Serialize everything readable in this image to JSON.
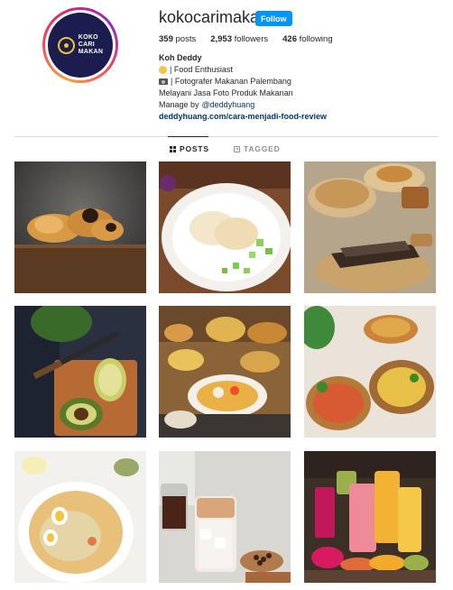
{
  "profile": {
    "username": "kokocarimakan",
    "follow_label": "Follow",
    "avatar_text": [
      "KOKO",
      "CARI",
      "MAKAN"
    ],
    "stats": {
      "posts_count": "359",
      "posts_label": "posts",
      "followers_count": "2,953",
      "followers_label": "followers",
      "following_count": "426",
      "following_label": "following"
    },
    "bio": {
      "name": "Koh Deddy",
      "line1": "| Food Enthusiast",
      "line2": "| Fotografer Makanan Palembang",
      "line3": "Melayani Jasa Foto Produk Makanan",
      "line4_prefix": "Manage by ",
      "mention": "@deddyhuang",
      "link": "deddyhuang.com/cara-menjadi-food-review"
    }
  },
  "tabs": {
    "posts": "POSTS",
    "tagged": "TAGGED"
  },
  "colors": {
    "follow_button": "#0095f6",
    "avatar_background": "#1b1d4f",
    "link": "#00376b"
  }
}
